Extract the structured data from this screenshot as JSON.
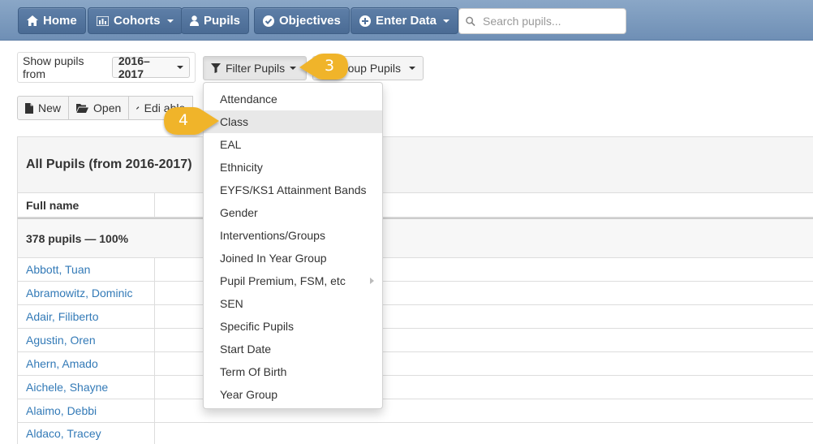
{
  "navbar": {
    "home": "Home",
    "cohorts": "Cohorts",
    "pupils": "Pupils",
    "objectives": "Objectives",
    "enter_data": "Enter Data",
    "search_placeholder": "Search pupils..."
  },
  "filters": {
    "show_pupils_label": "Show pupils from",
    "year_value": "2016–2017",
    "filter_button": "Filter Pupils",
    "group_button": "Group Pupils",
    "group_button_visible": "oup Pupils"
  },
  "toolbar": {
    "new": "New",
    "open": "Open",
    "edit_table": "Edit Table",
    "edit_table_visible": "Edi  able"
  },
  "table": {
    "title": "All Pupils (from 2016-2017)",
    "header_full_name": "Full name",
    "summary": "378 pupils — 100%",
    "pupils": [
      "Abbott, Tuan",
      "Abramowitz, Dominic",
      "Adair, Filiberto",
      "Agustin, Oren",
      "Ahern, Amado",
      "Aichele, Shayne",
      "Alaimo, Debbi",
      "Aldaco, Tracey"
    ]
  },
  "filter_menu": {
    "items": [
      "Attendance",
      "Class",
      "EAL",
      "Ethnicity",
      "EYFS/KS1 Attainment Bands",
      "Gender",
      "Interventions/Groups",
      "Joined In Year Group",
      "Pupil Premium, FSM, etc",
      "SEN",
      "Specific Pupils",
      "Start Date",
      "Term Of Birth",
      "Year Group"
    ],
    "highlighted": "Class",
    "has_submenu": "Pupil Premium, FSM, etc"
  },
  "callouts": {
    "step3": "3",
    "step4": "4"
  },
  "colors": {
    "navbar": "#7b9bc0",
    "nav_button": "#4f709a",
    "link": "#337ab7",
    "callout": "#f0b429"
  }
}
